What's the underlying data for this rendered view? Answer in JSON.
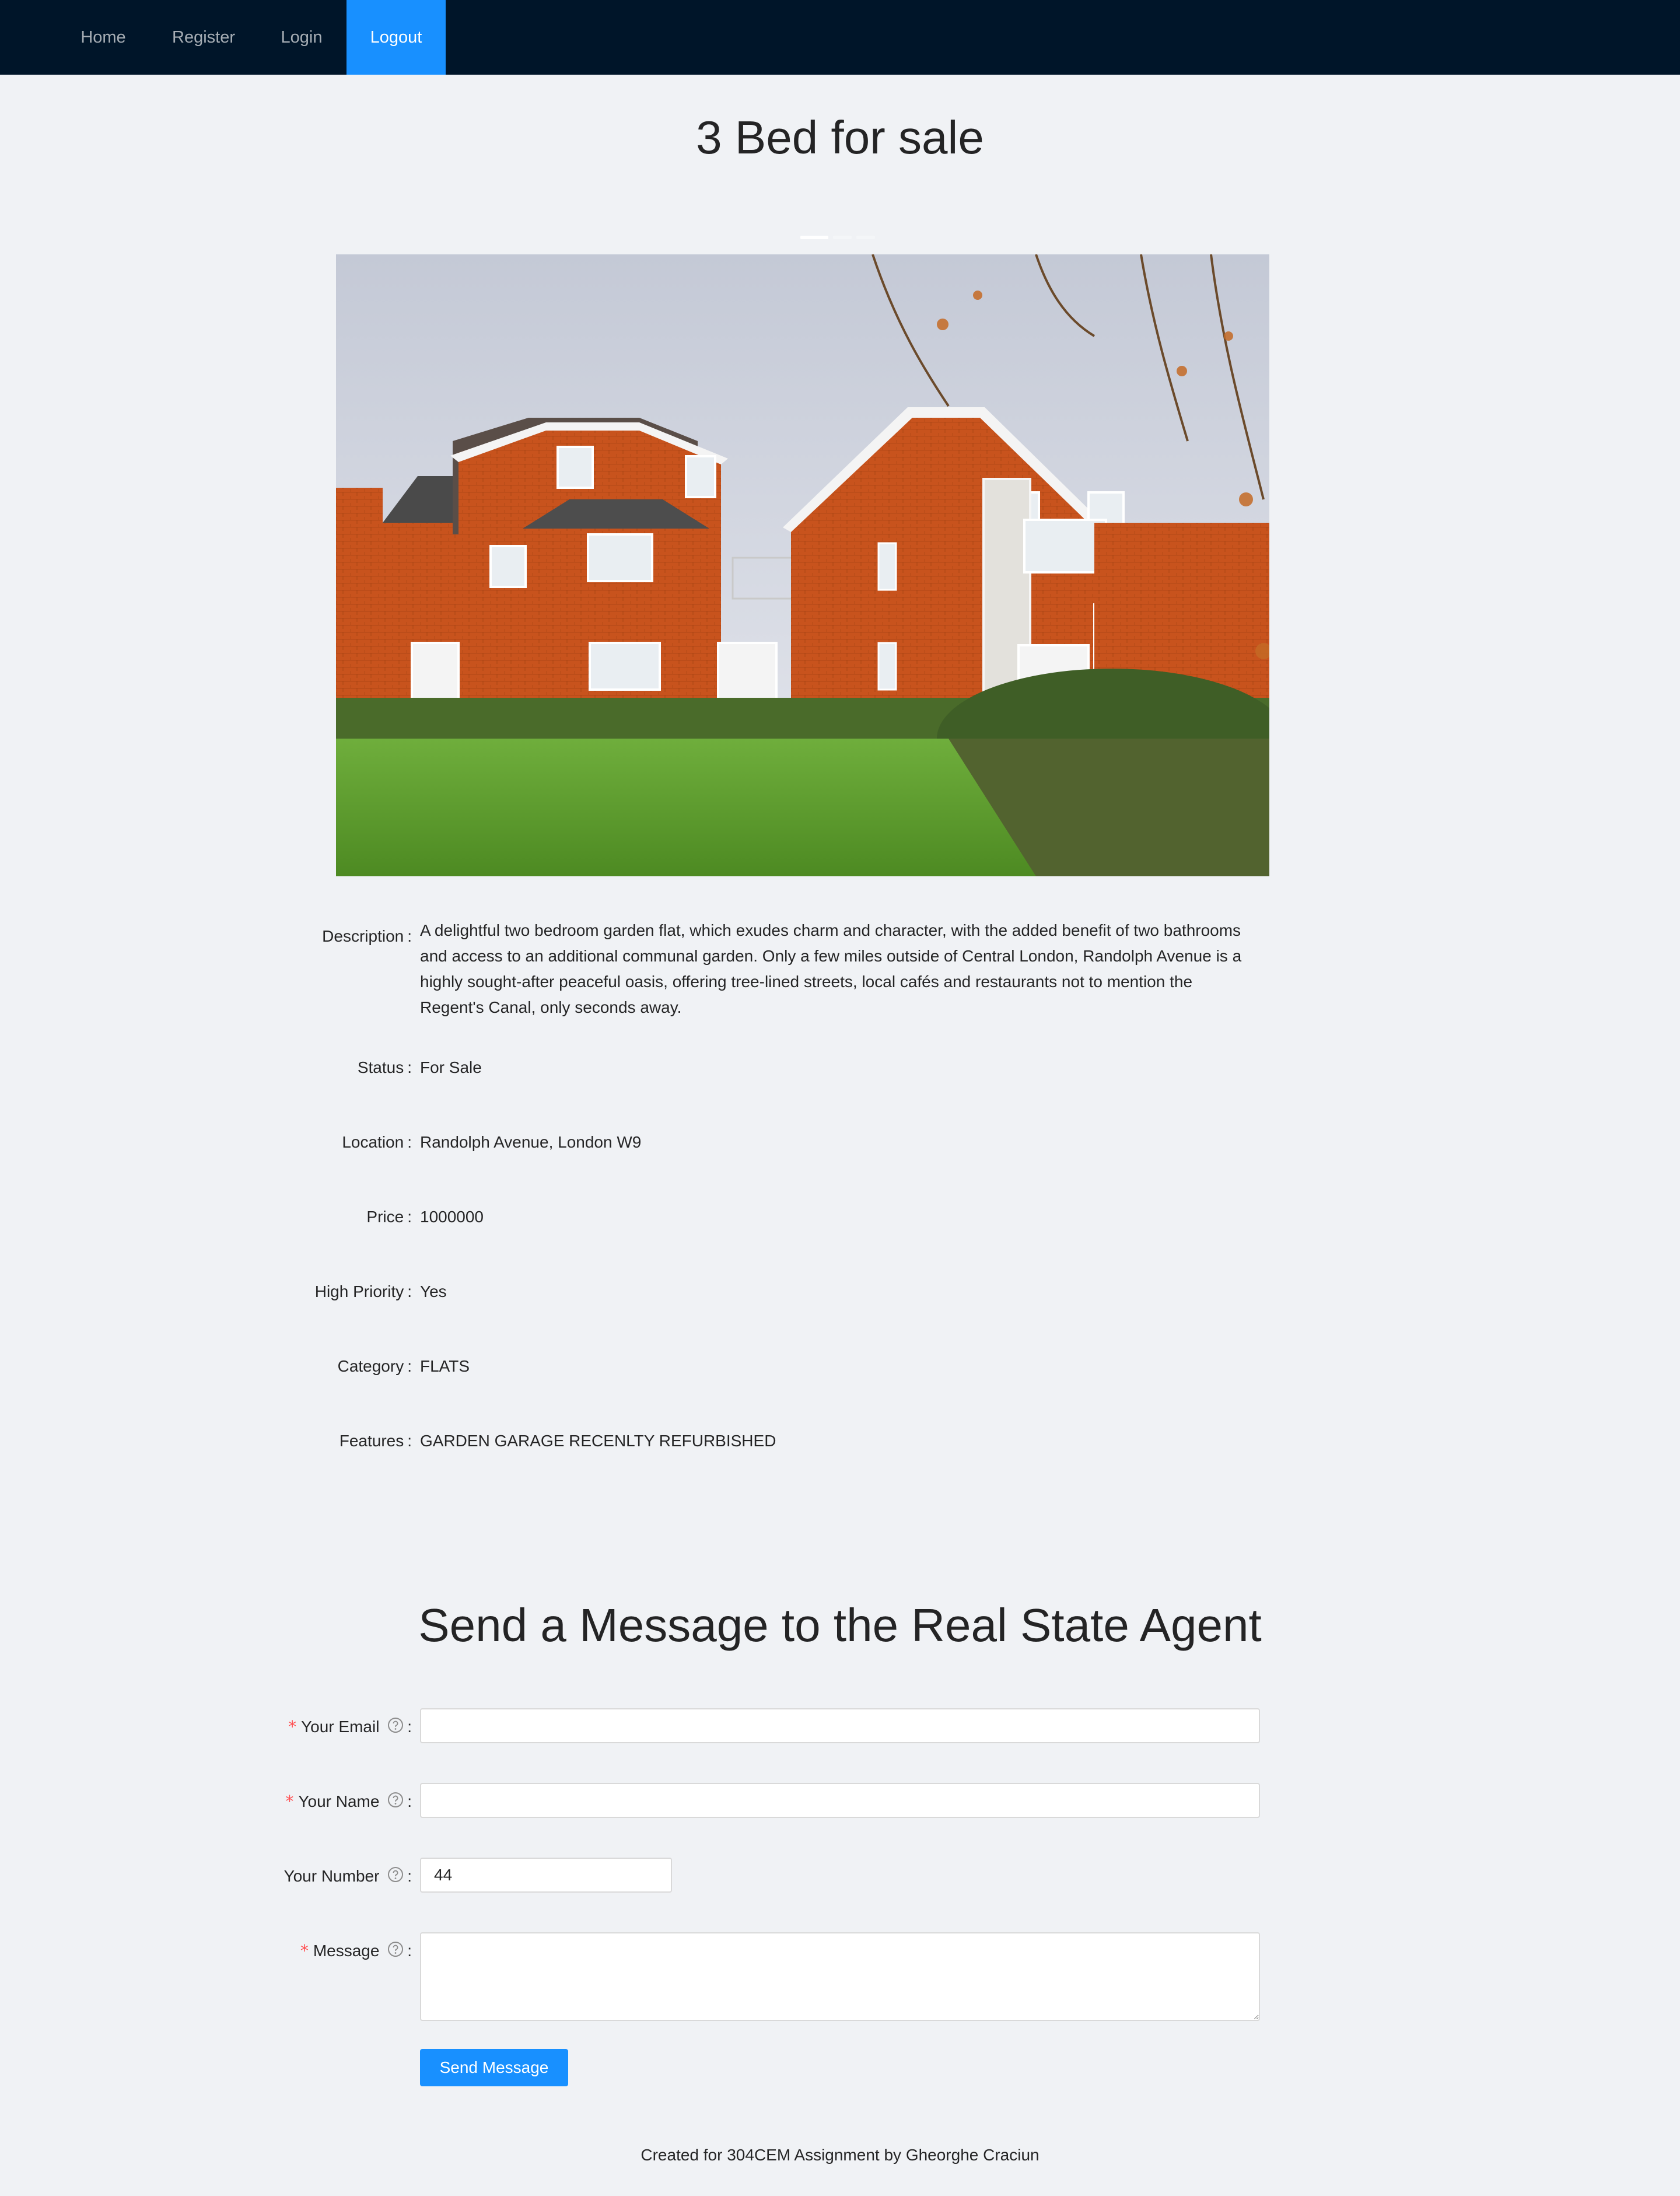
{
  "nav": {
    "items": [
      {
        "label": "Home"
      },
      {
        "label": "Register"
      },
      {
        "label": "Login"
      },
      {
        "label": "Logout",
        "active": true
      }
    ]
  },
  "page": {
    "title": "3 Bed for sale"
  },
  "carousel": {
    "slide_count": 3,
    "active_index": 0
  },
  "details": [
    {
      "label": "Description",
      "value": "A delightful two bedroom garden flat, which exudes charm and character, with the added benefit of two bathrooms and access to an additional communal garden. Only a few miles outside of Central London, Randolph Avenue is a highly sought-after peaceful oasis, offering tree-lined streets, local cafés and restaurants not to mention the Regent's Canal, only seconds away."
    },
    {
      "label": "Status",
      "value": "For Sale"
    },
    {
      "label": "Location",
      "value": "Randolph Avenue, London W9"
    },
    {
      "label": "Price",
      "value": "1000000"
    },
    {
      "label": "High Priority",
      "value": "Yes"
    },
    {
      "label": "Category",
      "value": "FLATS"
    },
    {
      "label": "Features",
      "value": "GARDEN GARAGE RECENLTY REFURBISHED"
    }
  ],
  "form": {
    "title": "Send a Message to the Real State Agent",
    "email_label": "Your Email",
    "name_label": "Your Name",
    "number_label": "Your Number",
    "number_value": "44",
    "message_label": "Message",
    "submit_label": "Send Message",
    "colon": ":",
    "required_mark": "*"
  },
  "footer": {
    "text": "Created for 304CEM Assignment by Gheorghe Craciun"
  },
  "colors": {
    "header_bg": "#001529",
    "accent": "#1890ff",
    "page_bg": "#f0f2f5"
  }
}
